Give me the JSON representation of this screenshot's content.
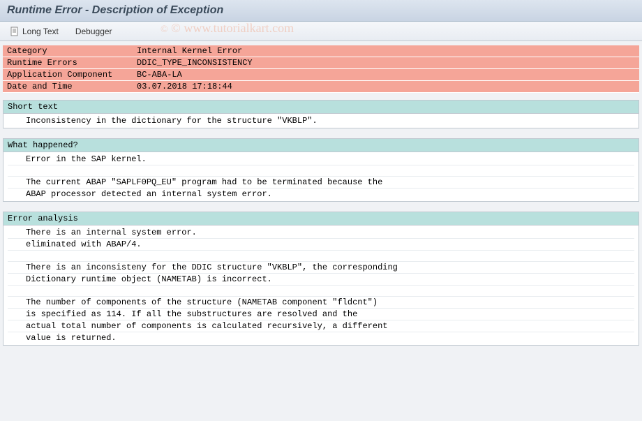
{
  "header": {
    "title": "Runtime Error - Description of Exception"
  },
  "toolbar": {
    "long_text": "Long Text",
    "debugger": "Debugger"
  },
  "info": {
    "category_label": "Category",
    "category_value": "Internal Kernel Error",
    "runtime_label": "Runtime Errors",
    "runtime_value": "DDIC_TYPE_INCONSISTENCY",
    "appcomp_label": "Application Component",
    "appcomp_value": "BC-ABA-LA",
    "datetime_label": "Date and Time",
    "datetime_value": "03.07.2018 17:18:44"
  },
  "sections": {
    "short_text": {
      "title": "Short text",
      "lines": [
        "Inconsistency in the dictionary for the structure \"VKBLP\"."
      ]
    },
    "what_happened": {
      "title": "What happened?",
      "lines": [
        "Error in the SAP kernel.",
        "",
        "The current ABAP \"SAPLF0PQ_EU\" program had to be terminated because the",
        "ABAP processor detected an internal system error."
      ]
    },
    "error_analysis": {
      "title": "Error analysis",
      "lines": [
        "There is an internal system error.",
        "eliminated with ABAP/4.",
        "",
        "There is an inconsisteny for the DDIC structure \"VKBLP\", the corresponding",
        "Dictionary runtime object (NAMETAB) is incorrect.",
        "",
        "The number of components of the structure (NAMETAB component \"fldcnt\")",
        "is specified as 114. If all the substructures are resolved and the",
        "actual total number of components is calculated recursively, a different",
        "value is returned."
      ]
    }
  },
  "watermark": "© www.tutorialkart.com"
}
